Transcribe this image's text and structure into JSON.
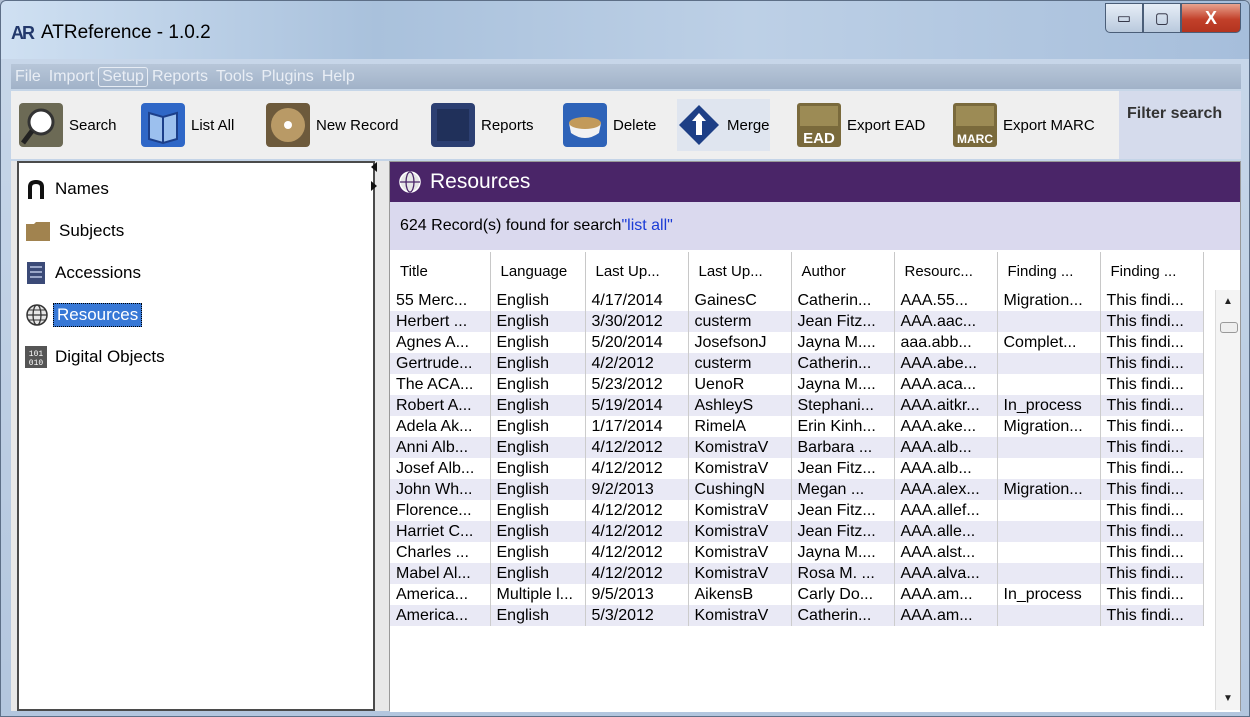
{
  "window": {
    "logo": "AR",
    "title": "ATReference - 1.0.2",
    "min": "▭",
    "max": "▢",
    "close": "X"
  },
  "menu": [
    "File",
    "Import",
    "Setup",
    "Reports",
    "Tools",
    "Plugins",
    "Help"
  ],
  "toolbar": {
    "search": "Search",
    "list_all": "List All",
    "new_record": "New Record",
    "reports": "Reports",
    "delete": "Delete",
    "merge": "Merge",
    "export_ead": "Export EAD",
    "export_marc": "Export MARC",
    "filter_search": "Filter search",
    "ead_badge": "EAD",
    "marc_badge": "MARC"
  },
  "sidebar": [
    {
      "label": "Names",
      "icon": "person-silhouette-icon"
    },
    {
      "label": "Subjects",
      "icon": "folder-icon"
    },
    {
      "label": "Accessions",
      "icon": "document-icon"
    },
    {
      "label": "Resources",
      "icon": "globe-icon"
    },
    {
      "label": "Digital Objects",
      "icon": "binary-icon"
    }
  ],
  "content": {
    "header": "Resources",
    "records_prefix": "624 Record(s) found for search ",
    "records_query": "\"list all\"",
    "columns": [
      "Title",
      "Language",
      "Last Up...",
      "Last Up...",
      "Author",
      "Resourc...",
      "Finding ...",
      "Finding ..."
    ],
    "rows": [
      [
        "55 Merc...",
        "English",
        "4/17/2014",
        "GainesC",
        "Catherin...",
        "AAA.55...",
        "Migration...",
        "This findi..."
      ],
      [
        "Herbert ...",
        "English",
        "3/30/2012",
        "custerm",
        "Jean Fitz...",
        "AAA.aac...",
        "",
        "This findi..."
      ],
      [
        "Agnes A...",
        "English",
        "5/20/2014",
        "JosefsonJ",
        "Jayna M....",
        "aaa.abb...",
        "Complet...",
        "This findi..."
      ],
      [
        "Gertrude...",
        "English",
        "4/2/2012",
        "custerm",
        "Catherin...",
        "AAA.abe...",
        "",
        "This findi..."
      ],
      [
        "The ACA...",
        "English",
        "5/23/2012",
        "UenoR",
        "Jayna M....",
        "AAA.aca...",
        "",
        "This findi..."
      ],
      [
        "Robert A...",
        "English",
        "5/19/2014",
        "AshleyS",
        "Stephani...",
        "AAA.aitkr...",
        "In_process",
        "This findi..."
      ],
      [
        "Adela Ak...",
        "English",
        "1/17/2014",
        "RimelA",
        "Erin Kinh...",
        "AAA.ake...",
        "Migration...",
        "This findi..."
      ],
      [
        "Anni Alb...",
        "English",
        "4/12/2012",
        "KomistraV",
        "Barbara ...",
        "AAA.alb...",
        "",
        "This findi..."
      ],
      [
        "Josef Alb...",
        "English",
        "4/12/2012",
        "KomistraV",
        "Jean Fitz...",
        "AAA.alb...",
        "",
        "This findi..."
      ],
      [
        "John Wh...",
        "English",
        "9/2/2013",
        "CushingN",
        "Megan ...",
        "AAA.alex...",
        "Migration...",
        "This findi..."
      ],
      [
        "Florence...",
        "English",
        "4/12/2012",
        "KomistraV",
        "Jean Fitz...",
        "AAA.allef...",
        "",
        "This findi..."
      ],
      [
        "Harriet C...",
        "English",
        "4/12/2012",
        "KomistraV",
        "Jean Fitz...",
        "AAA.alle...",
        "",
        "This findi..."
      ],
      [
        "Charles ...",
        "English",
        "4/12/2012",
        "KomistraV",
        "Jayna M....",
        "AAA.alst...",
        "",
        "This findi..."
      ],
      [
        "Mabel Al...",
        "English",
        "4/12/2012",
        "KomistraV",
        "Rosa M. ...",
        "AAA.alva...",
        "",
        "This findi..."
      ],
      [
        "America...",
        "Multiple l...",
        "9/5/2013",
        "AikensB",
        "Carly Do...",
        "AAA.am...",
        "In_process",
        "This findi..."
      ],
      [
        "America...",
        "English",
        "5/3/2012",
        "KomistraV",
        "Catherin...",
        "AAA.am...",
        "",
        "This findi..."
      ]
    ]
  },
  "colors": {
    "resources_header": "#4a2568",
    "selection": "#3778d6",
    "alt_row": "#e9e9f5",
    "query_link": "#1a3bd6"
  }
}
